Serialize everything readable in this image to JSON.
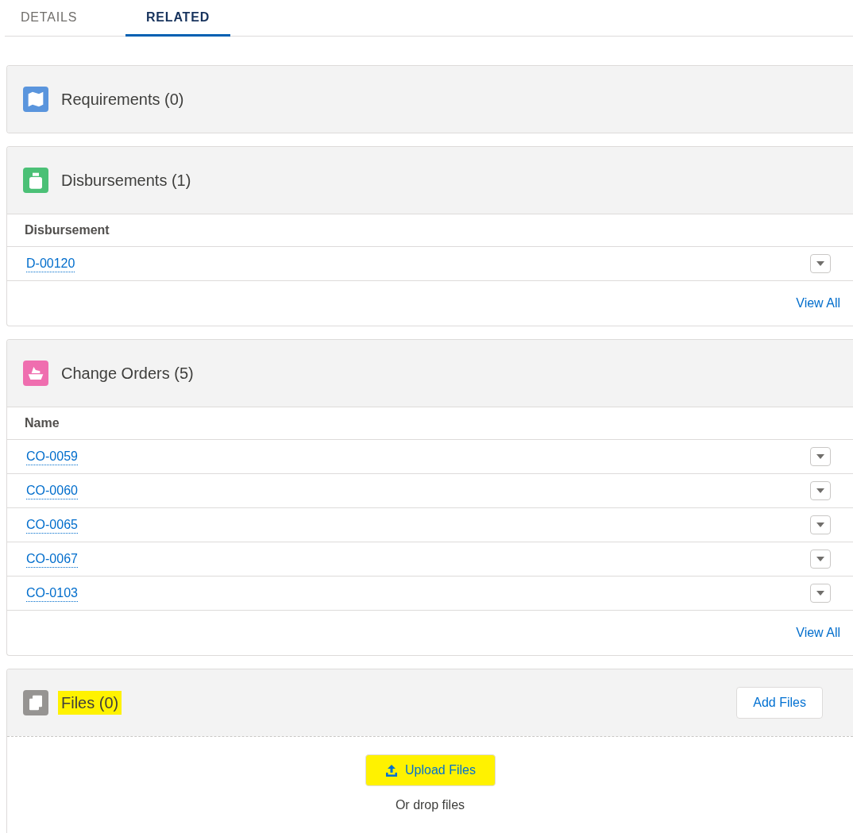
{
  "tabs": [
    {
      "label": "DETAILS",
      "selected": false
    },
    {
      "label": "RELATED",
      "selected": true
    }
  ],
  "cards": [
    {
      "kind": "list",
      "title": "Requirements (0)"
    },
    {
      "kind": "table",
      "title": "Disbursements (1)",
      "column": "Disbursement",
      "rows": [
        "D-00120"
      ],
      "footer_link": "View All"
    },
    {
      "kind": "table",
      "title": "Change Orders (5)",
      "column": "Name",
      "rows": [
        "CO-0059",
        "CO-0060",
        "CO-0065",
        "CO-0067",
        "CO-0103"
      ],
      "footer_link": "View All"
    },
    {
      "kind": "files",
      "title": "Files (0)",
      "title_highlighted": true,
      "action": "Add Files",
      "upload_button": "Upload Files",
      "upload_highlighted": true,
      "drop_text": "Or drop files"
    }
  ]
}
